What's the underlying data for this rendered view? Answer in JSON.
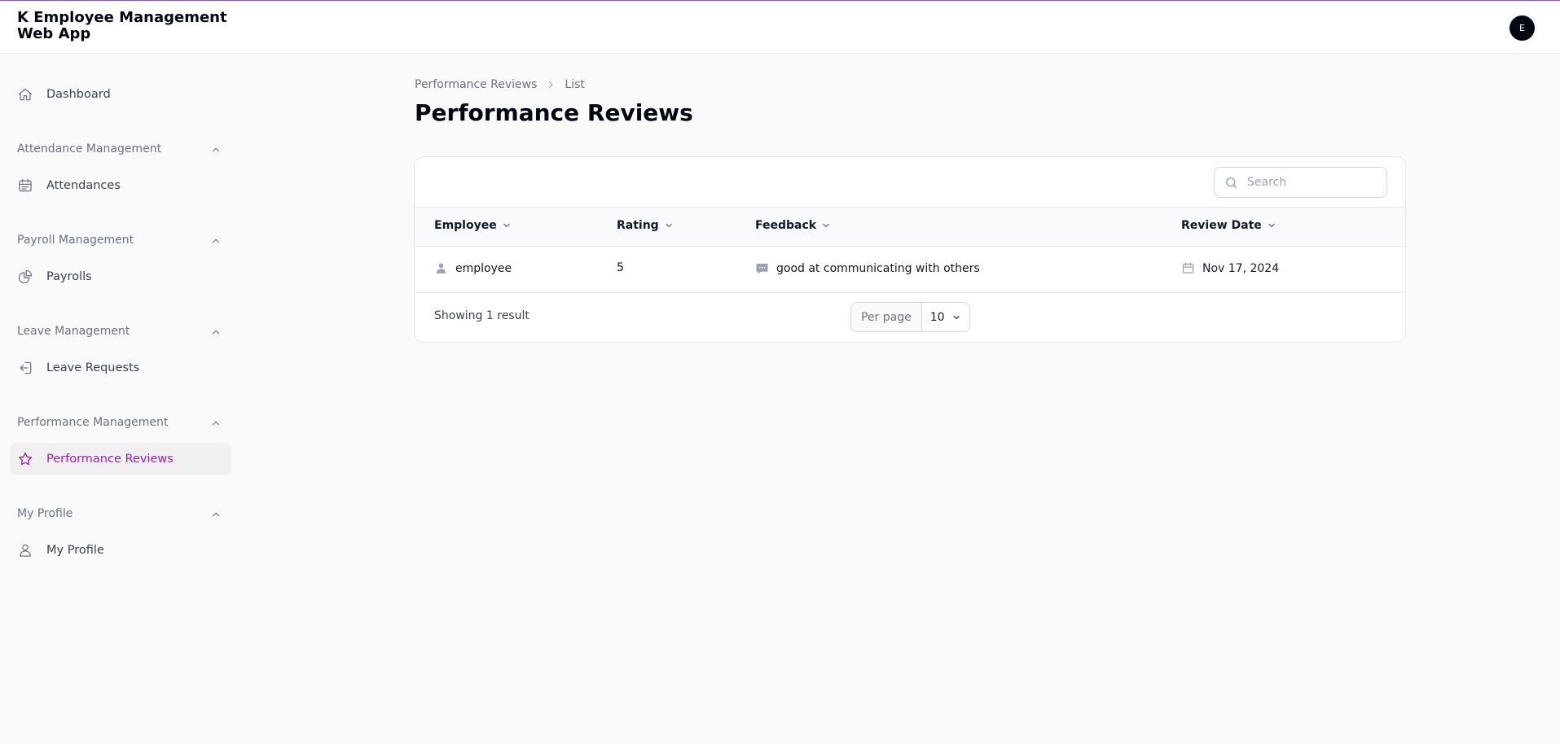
{
  "app": {
    "title": "K Employee Management Web App",
    "user_initial": "E"
  },
  "sidebar": {
    "dashboard": {
      "label": "Dashboard",
      "icon": "home-icon"
    },
    "groups": [
      {
        "label": "Attendance Management",
        "items": [
          {
            "label": "Attendances",
            "icon": "calendar-icon"
          }
        ]
      },
      {
        "label": "Payroll Management",
        "items": [
          {
            "label": "Payrolls",
            "icon": "pie-chart-icon"
          }
        ]
      },
      {
        "label": "Leave Management",
        "items": [
          {
            "label": "Leave Requests",
            "icon": "logout-icon"
          }
        ]
      },
      {
        "label": "Performance Management",
        "items": [
          {
            "label": "Performance Reviews",
            "icon": "star-icon",
            "active": true
          }
        ]
      },
      {
        "label": "My Profile",
        "items": [
          {
            "label": "My Profile",
            "icon": "user-icon"
          }
        ]
      }
    ]
  },
  "breadcrumb": {
    "parent": "Performance Reviews",
    "current": "List"
  },
  "page": {
    "title": "Performance Reviews"
  },
  "search": {
    "placeholder": "Search",
    "value": ""
  },
  "table": {
    "columns": [
      "Employee",
      "Rating",
      "Feedback",
      "Review Date"
    ],
    "rows": [
      {
        "employee": "employee",
        "rating": "5",
        "feedback": "good at communicating with others",
        "review_date": "Nov 17, 2024"
      }
    ],
    "result_text": "Showing 1 result",
    "per_page_label": "Per page",
    "per_page_value": "10"
  },
  "colors": {
    "accent": "#a21caf",
    "active_bg": "#f0f0f1",
    "top_border": "#7c5ca8"
  }
}
